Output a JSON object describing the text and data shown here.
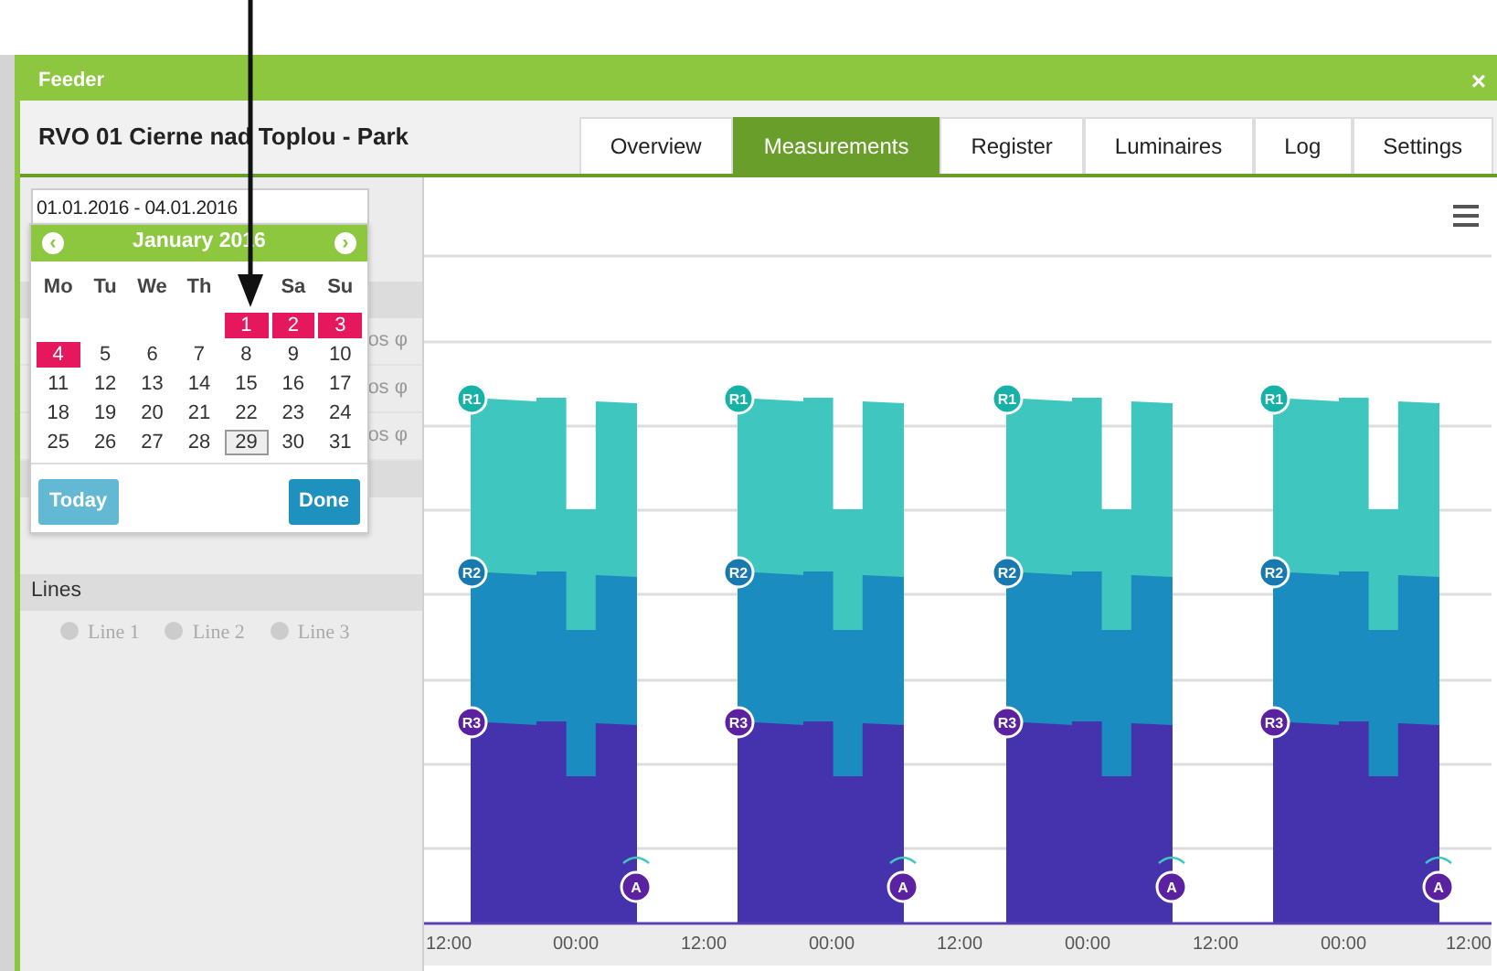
{
  "window": {
    "title": "Feeder",
    "close": "×"
  },
  "header": {
    "title": "RVO 01 Cierne nad Toplou - Park"
  },
  "tabs": [
    {
      "label": "Overview",
      "selected": false
    },
    {
      "label": "Measurements",
      "selected": true
    },
    {
      "label": "Register",
      "selected": false
    },
    {
      "label": "Luminaires",
      "selected": false
    },
    {
      "label": "Log",
      "selected": false
    },
    {
      "label": "Settings",
      "selected": false
    }
  ],
  "date_range": {
    "value": "01.01.2016 - 04.01.2016"
  },
  "calendar": {
    "month": "January 2016",
    "prev": "‹",
    "next": "›",
    "weekdays": [
      {
        "kind": "label",
        "label": "Mo"
      },
      {
        "kind": "label",
        "label": "Tu"
      },
      {
        "kind": "label",
        "label": "We"
      },
      {
        "kind": "label",
        "label": "Th"
      },
      {
        "kind": "covered"
      },
      {
        "kind": "label",
        "label": "Sa"
      },
      {
        "kind": "label",
        "label": "Su"
      }
    ],
    "first_week_partial": true,
    "weeks": [
      [
        {
          "day": "1",
          "selected": true,
          "today": false
        },
        {
          "day": "2",
          "selected": true,
          "today": false
        },
        {
          "day": "3",
          "selected": true,
          "today": false
        }
      ],
      [
        {
          "day": "4",
          "selected": true,
          "today": false
        },
        {
          "day": "5",
          "selected": false,
          "today": false
        },
        {
          "day": "6",
          "selected": false,
          "today": false
        },
        {
          "day": "7",
          "selected": false,
          "today": false
        },
        {
          "day": "8",
          "selected": false,
          "today": false
        },
        {
          "day": "9",
          "selected": false,
          "today": false
        },
        {
          "day": "10",
          "selected": false,
          "today": false
        }
      ],
      [
        {
          "day": "11",
          "selected": false,
          "today": false
        },
        {
          "day": "12",
          "selected": false,
          "today": false
        },
        {
          "day": "13",
          "selected": false,
          "today": false
        },
        {
          "day": "14",
          "selected": false,
          "today": false
        },
        {
          "day": "15",
          "selected": false,
          "today": false
        },
        {
          "day": "16",
          "selected": false,
          "today": false
        },
        {
          "day": "17",
          "selected": false,
          "today": false
        }
      ],
      [
        {
          "day": "18",
          "selected": false,
          "today": false
        },
        {
          "day": "19",
          "selected": false,
          "today": false
        },
        {
          "day": "20",
          "selected": false,
          "today": false
        },
        {
          "day": "21",
          "selected": false,
          "today": false
        },
        {
          "day": "22",
          "selected": false,
          "today": false
        },
        {
          "day": "23",
          "selected": false,
          "today": false
        },
        {
          "day": "24",
          "selected": false,
          "today": false
        }
      ],
      [
        {
          "day": "25",
          "selected": false,
          "today": false
        },
        {
          "day": "26",
          "selected": false,
          "today": false
        },
        {
          "day": "27",
          "selected": false,
          "today": false
        },
        {
          "day": "28",
          "selected": false,
          "today": false
        },
        {
          "day": "29",
          "selected": false,
          "today": true
        },
        {
          "day": "30",
          "selected": false,
          "today": false
        },
        {
          "day": "31",
          "selected": false,
          "today": false
        }
      ]
    ],
    "buttons": [
      "Today",
      "Done"
    ]
  },
  "hidden_rows": [
    "os φ",
    "os φ",
    "os φ"
  ],
  "lines": {
    "title": "Lines",
    "items": [
      "Line 1",
      "Line 2",
      "Line 3"
    ]
  },
  "chart": {
    "layers": [
      {
        "color": "#3fc7bf"
      },
      {
        "color": "#1a8cbf"
      },
      {
        "color": "#4533ae"
      }
    ],
    "blocks": [
      {
        "markers": [
          "R1",
          "R2",
          "R3"
        ],
        "alarm": "A"
      },
      {
        "markers": [
          "R1",
          "R2",
          "R3"
        ],
        "alarm": "A"
      },
      {
        "markers": [
          "R1",
          "R2",
          "R3"
        ],
        "alarm": "A"
      },
      {
        "markers": [
          "R1",
          "R2",
          "R3"
        ],
        "alarm": "A"
      }
    ],
    "x_labels": [
      "12:00",
      "00:00",
      "12:00",
      "00:00",
      "12:00",
      "00:00",
      "12:00",
      "00:00",
      "12:00"
    ]
  }
}
